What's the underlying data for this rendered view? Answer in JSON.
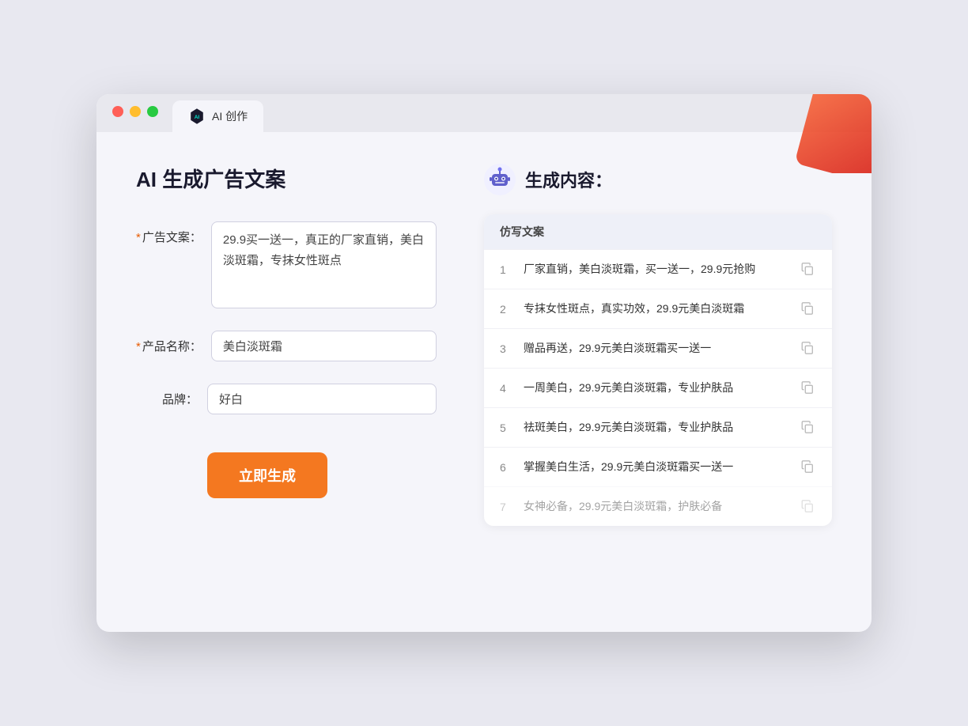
{
  "browser": {
    "tab_label": "AI 创作"
  },
  "page": {
    "title": "AI 生成广告文案",
    "form": {
      "ad_copy_label": "广告文案：",
      "ad_copy_required": "*",
      "ad_copy_value": "29.9买一送一，真正的厂家直销，美白淡斑霜，专抹女性斑点",
      "product_name_label": "产品名称：",
      "product_name_required": "*",
      "product_name_value": "美白淡斑霜",
      "brand_label": "品牌：",
      "brand_value": "好白",
      "generate_button": "立即生成"
    },
    "result": {
      "header_label": "生成内容：",
      "table_header": "仿写文案",
      "items": [
        {
          "num": "1",
          "text": "厂家直销，美白淡斑霜，买一送一，29.9元抢购"
        },
        {
          "num": "2",
          "text": "专抹女性斑点，真实功效，29.9元美白淡斑霜"
        },
        {
          "num": "3",
          "text": "赠品再送，29.9元美白淡斑霜买一送一"
        },
        {
          "num": "4",
          "text": "一周美白，29.9元美白淡斑霜，专业护肤品"
        },
        {
          "num": "5",
          "text": "祛斑美白，29.9元美白淡斑霜，专业护肤品"
        },
        {
          "num": "6",
          "text": "掌握美白生活，29.9元美白淡斑霜买一送一"
        },
        {
          "num": "7",
          "text": "女神必备，29.9元美白淡斑霜，护肤必备"
        }
      ]
    }
  },
  "icons": {
    "copy": "📋",
    "robot_emoji": "🤖"
  }
}
